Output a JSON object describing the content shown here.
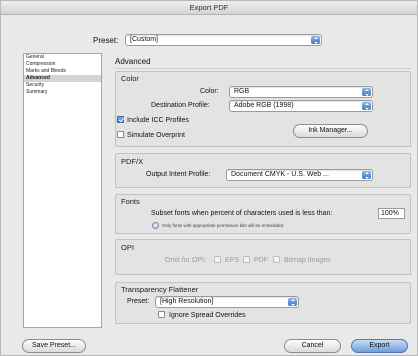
{
  "window": {
    "title": "Export PDF"
  },
  "preset": {
    "label": "Preset:",
    "value": "[Custom]"
  },
  "sidebar": {
    "items": [
      {
        "label": "General",
        "selected": false
      },
      {
        "label": "Compression",
        "selected": false
      },
      {
        "label": "Marks and Bleeds",
        "selected": false
      },
      {
        "label": "Advanced",
        "selected": true
      },
      {
        "label": "Security",
        "selected": false
      },
      {
        "label": "Summary",
        "selected": false
      }
    ]
  },
  "section_title": "Advanced",
  "color": {
    "title": "Color",
    "color_label": "Color:",
    "color_value": "RGB",
    "dest_label": "Destination Profile:",
    "dest_value": "Adobe RGB (1998)",
    "include_icc_label": "Include ICC Profiles",
    "include_icc_checked": true,
    "simulate_label": "Simulate Overprint",
    "simulate_checked": false,
    "ink_manager_label": "Ink Manager..."
  },
  "pdfx": {
    "title": "PDF/X",
    "output_intent_label": "Output Intent Profile:",
    "output_intent_value": "Document CMYK - U.S. Web ..."
  },
  "fonts": {
    "title": "Fonts",
    "subset_label": "Subset fonts when percent of characters used is less than:",
    "subset_value": "100%",
    "note": "Only fonts with appropriate permission bits will be embedded."
  },
  "opi": {
    "title": "OPI",
    "omit_label": "Omit for OPI:",
    "eps_label": "EPS",
    "pdf_label": "PDF",
    "bitmap_label": "Bitmap Images"
  },
  "flattener": {
    "title": "Transparency Flattener",
    "preset_label": "Preset:",
    "preset_value": "[High Resolution]",
    "ignore_label": "Ignore Spread Overrides",
    "ignore_checked": false
  },
  "buttons": {
    "save_preset": "Save Preset...",
    "cancel": "Cancel",
    "export": "Export"
  },
  "colors": {
    "accent": "#3f78c8",
    "panel": "#e9e9e9"
  }
}
